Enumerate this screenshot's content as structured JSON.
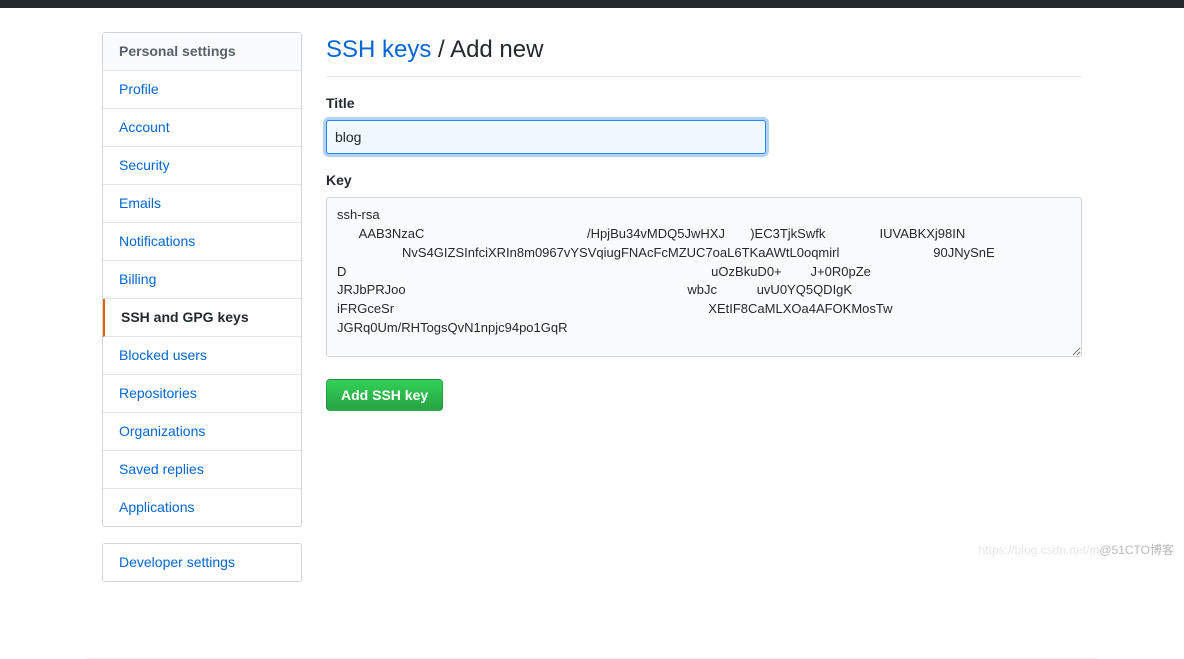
{
  "sidebar": {
    "heading": "Personal settings",
    "items": [
      {
        "label": "Profile",
        "selected": false
      },
      {
        "label": "Account",
        "selected": false
      },
      {
        "label": "Security",
        "selected": false
      },
      {
        "label": "Emails",
        "selected": false
      },
      {
        "label": "Notifications",
        "selected": false
      },
      {
        "label": "Billing",
        "selected": false
      },
      {
        "label": "SSH and GPG keys",
        "selected": true
      },
      {
        "label": "Blocked users",
        "selected": false
      },
      {
        "label": "Repositories",
        "selected": false
      },
      {
        "label": "Organizations",
        "selected": false
      },
      {
        "label": "Saved replies",
        "selected": false
      },
      {
        "label": "Applications",
        "selected": false
      }
    ],
    "secondary": [
      {
        "label": "Developer settings"
      }
    ]
  },
  "header": {
    "link_label": "SSH keys",
    "separator": " / ",
    "current": "Add new"
  },
  "form": {
    "title_label": "Title",
    "title_value": "blog",
    "key_label": "Key",
    "key_value": "ssh-rsa\n      AAB3NzaC                                             /HpjBu34vMDQ5JwHXJ       )EC3TjkSwfk               IUVABKXj98IN\n                  NvS4GIZSInfciXRIn8m0967vYSVqiugFNAcFcMZUC7oaL6TKaAWtL0oqmirl                          90JNySnE\nD                                                                                                     uOzBkuD0+        J+0R0pZe\nJRJbPRJoo                                                                              wbJc           uvU0YQ5QDIgK\niFRGceSr                                                                                       XEtIF8CaMLXOa4AFOKMosTw\nJGRq0Um/RHTogsQvN1npjc94po1GqR",
    "submit_label": "Add SSH key"
  },
  "watermark": {
    "faint": "https://blog.csdn.net/m",
    "text": "@51CTO博客"
  }
}
